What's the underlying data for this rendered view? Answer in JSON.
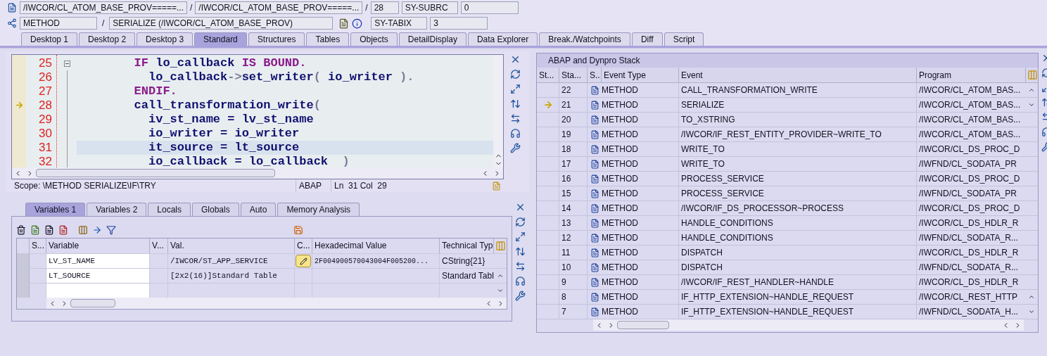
{
  "header": {
    "program_fields": [
      "/IWCOR/CL_ATOM_BASE_PROV=====...",
      "/IWCOR/CL_ATOM_BASE_PROV=====..."
    ],
    "separator": "/",
    "line": "28",
    "event_type": "METHOD",
    "event": "SERIALIZE (/IWCOR/CL_ATOM_BASE_PROV)",
    "sy_fields": [
      {
        "name": "SY-SUBRC",
        "value": "0"
      },
      {
        "name": "SY-TABIX",
        "value": "3"
      }
    ]
  },
  "desktop_tabs": [
    {
      "label": "Desktop 1",
      "selected": false
    },
    {
      "label": "Desktop 2",
      "selected": false
    },
    {
      "label": "Desktop 3",
      "selected": false
    },
    {
      "label": "Standard",
      "selected": true
    },
    {
      "label": "Structures",
      "selected": false
    },
    {
      "label": "Tables",
      "selected": false
    },
    {
      "label": "Objects",
      "selected": false
    },
    {
      "label": "DetailDisplay",
      "selected": false
    },
    {
      "label": "Data Explorer",
      "selected": false
    },
    {
      "label": "Break./Watchpoints",
      "selected": false
    },
    {
      "label": "Diff",
      "selected": false
    },
    {
      "label": "Script",
      "selected": false
    }
  ],
  "editor": {
    "lines": [
      {
        "number": "25",
        "current": false,
        "highlighted": false,
        "tokens": [
          {
            "text": "        IF",
            "kind": "keyword"
          },
          {
            "text": " lo_callback ",
            "kind": "ident"
          },
          {
            "text": "IS BOUND.",
            "kind": "keyword"
          }
        ]
      },
      {
        "number": "26",
        "current": false,
        "highlighted": false,
        "tokens": [
          {
            "text": "          lo_callback",
            "kind": "ident"
          },
          {
            "text": "->",
            "kind": "punct"
          },
          {
            "text": "set_writer",
            "kind": "ident"
          },
          {
            "text": "( ",
            "kind": "punct"
          },
          {
            "text": "io_writer",
            "kind": "ident"
          },
          {
            "text": " ).",
            "kind": "punct"
          }
        ]
      },
      {
        "number": "27",
        "current": false,
        "highlighted": false,
        "tokens": [
          {
            "text": "        ENDIF.",
            "kind": "keyword"
          }
        ]
      },
      {
        "number": "28",
        "current": true,
        "highlighted": false,
        "tokens": [
          {
            "text": "        call_transformation_write",
            "kind": "ident"
          },
          {
            "text": "(",
            "kind": "punct"
          }
        ]
      },
      {
        "number": "29",
        "current": false,
        "highlighted": false,
        "tokens": [
          {
            "text": "          iv_st_name = lv_st_name",
            "kind": "ident"
          }
        ]
      },
      {
        "number": "30",
        "current": false,
        "highlighted": false,
        "tokens": [
          {
            "text": "          io_writer = io_writer",
            "kind": "ident"
          }
        ]
      },
      {
        "number": "31",
        "current": false,
        "highlighted": true,
        "tokens": [
          {
            "text": "          it_source = lt_source",
            "kind": "ident"
          }
        ]
      },
      {
        "number": "32",
        "current": false,
        "highlighted": false,
        "tokens": [
          {
            "text": "          io_callback = lo_callback",
            "kind": "ident"
          },
          {
            "text": "  )",
            "kind": "punct"
          }
        ]
      }
    ],
    "scope": "Scope: \\METHOD SERIALIZE\\IF\\TRY",
    "language": "ABAP",
    "position": "Ln  31 Col  29"
  },
  "variable_tabs": [
    {
      "label": "Variables 1",
      "selected": true
    },
    {
      "label": "Variables 2",
      "selected": false
    },
    {
      "label": "Locals",
      "selected": false
    },
    {
      "label": "Globals",
      "selected": false
    },
    {
      "label": "Auto",
      "selected": false
    },
    {
      "label": "Memory Analysis",
      "selected": false
    }
  ],
  "variables": {
    "columns": [
      "S...",
      "Variable",
      "V...",
      "Val.",
      "C...",
      "Hexadecimal Value",
      "Technical Typ"
    ],
    "rows": [
      {
        "variable": "LV_ST_NAME",
        "value": "/IWCOR/ST_APP_SERVICE",
        "editable": true,
        "hex": "2F004900570043004F005200...",
        "type": "CString{21}"
      },
      {
        "variable": "LT_SOURCE",
        "value": "[2x2(16)]Standard Table",
        "editable": false,
        "hex": "",
        "type": "Standard Tabl"
      }
    ]
  },
  "stack": {
    "title": "ABAP and Dynpro Stack",
    "columns": [
      "St...",
      "Sta...",
      "S..",
      "Event Type",
      "Event",
      "Program"
    ],
    "rows": [
      {
        "current": false,
        "level": "22",
        "type": "METHOD",
        "event": "CALL_TRANSFORMATION_WRITE",
        "program": "/IWCOR/CL_ATOM_BAS..."
      },
      {
        "current": true,
        "level": "21",
        "type": "METHOD",
        "event": "SERIALIZE",
        "program": "/IWCOR/CL_ATOM_BAS..."
      },
      {
        "current": false,
        "level": "20",
        "type": "METHOD",
        "event": "TO_XSTRING",
        "program": "/IWCOR/CL_ATOM_BAS..."
      },
      {
        "current": false,
        "level": "19",
        "type": "METHOD",
        "event": "/IWCOR/IF_REST_ENTITY_PROVIDER~WRITE_TO",
        "program": "/IWCOR/CL_ATOM_BAS..."
      },
      {
        "current": false,
        "level": "18",
        "type": "METHOD",
        "event": "WRITE_TO",
        "program": "/IWCOR/CL_DS_PROC_D"
      },
      {
        "current": false,
        "level": "17",
        "type": "METHOD",
        "event": "WRITE_TO",
        "program": "/IWFND/CL_SODATA_PR"
      },
      {
        "current": false,
        "level": "16",
        "type": "METHOD",
        "event": "PROCESS_SERVICE",
        "program": "/IWCOR/CL_DS_PROC_D"
      },
      {
        "current": false,
        "level": "15",
        "type": "METHOD",
        "event": "PROCESS_SERVICE",
        "program": "/IWFND/CL_SODATA_PR"
      },
      {
        "current": false,
        "level": "14",
        "type": "METHOD",
        "event": "/IWCOR/IF_DS_PROCESSOR~PROCESS",
        "program": "/IWCOR/CL_DS_PROC_D"
      },
      {
        "current": false,
        "level": "13",
        "type": "METHOD",
        "event": "HANDLE_CONDITIONS",
        "program": "/IWCOR/CL_DS_HDLR_R"
      },
      {
        "current": false,
        "level": "12",
        "type": "METHOD",
        "event": "HANDLE_CONDITIONS",
        "program": "/IWFND/CL_SODATA_R..."
      },
      {
        "current": false,
        "level": "11",
        "type": "METHOD",
        "event": "DISPATCH",
        "program": "/IWCOR/CL_DS_HDLR_R"
      },
      {
        "current": false,
        "level": "10",
        "type": "METHOD",
        "event": "DISPATCH",
        "program": "/IWFND/CL_SODATA_R..."
      },
      {
        "current": false,
        "level": "9",
        "type": "METHOD",
        "event": "/IWCOR/IF_REST_HANDLER~HANDLE",
        "program": "/IWCOR/CL_DS_HDLR_R"
      },
      {
        "current": false,
        "level": "8",
        "type": "METHOD",
        "event": "IF_HTTP_EXTENSION~HANDLE_REQUEST",
        "program": "/IWCOR/CL_REST_HTTP"
      },
      {
        "current": false,
        "level": "7",
        "type": "METHOD",
        "event": "IF_HTTP_EXTENSION~HANDLE_REQUEST",
        "program": "/IWFND/CL_SODATA_H..."
      }
    ]
  }
}
